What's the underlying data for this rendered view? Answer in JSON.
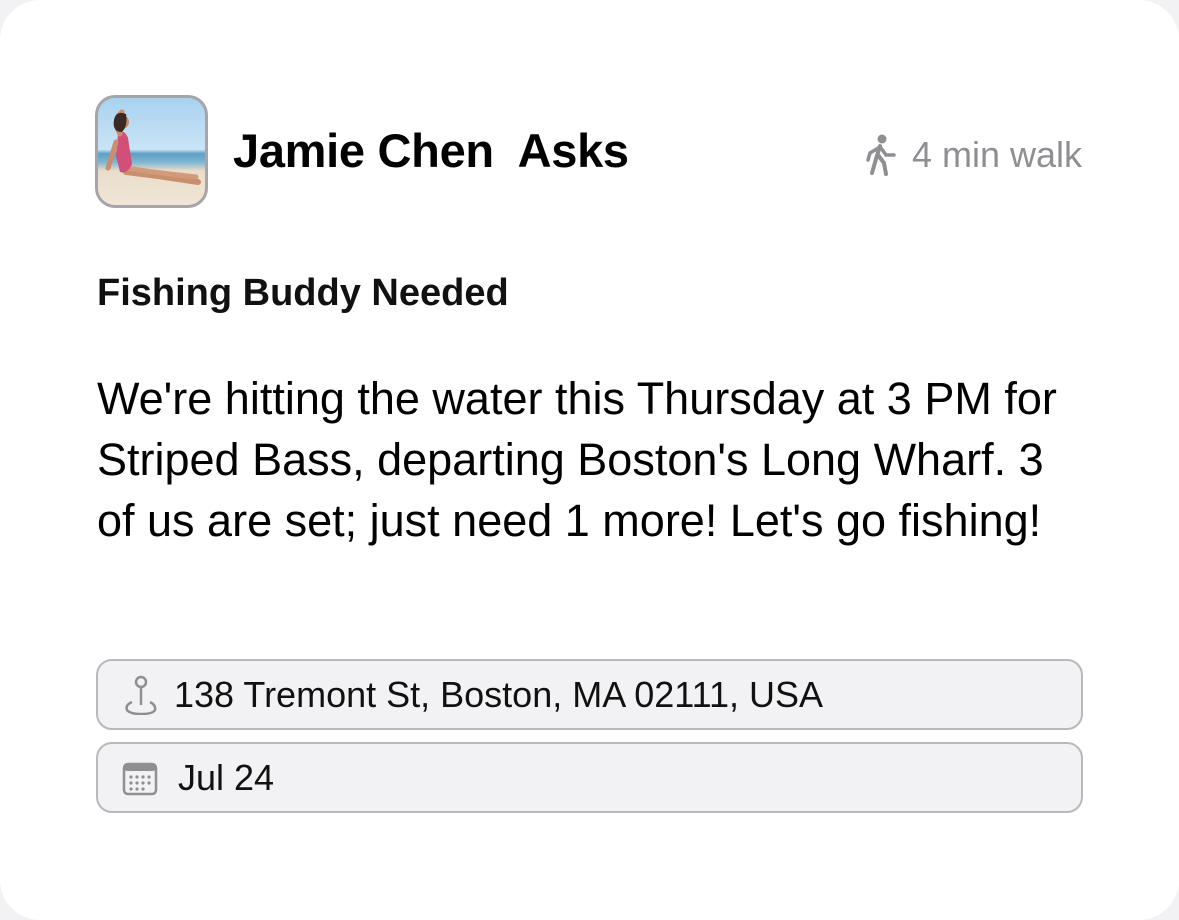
{
  "post": {
    "author_name": "Jamie Chen  Asks",
    "distance": "4 min walk",
    "title": "Fishing Buddy Needed",
    "body": "We're hitting the water this Thursday at 3 PM for Striped Bass, departing Boston's Long Wharf. 3 of us are set; just need 1 more! Let's go fishing!",
    "location": "138 Tremont St, Boston, MA 02111, USA",
    "date": "Jul 24"
  },
  "icons": {
    "distance": "walking-person-icon",
    "location": "location-pin-icon",
    "date": "calendar-icon"
  },
  "colors": {
    "secondary_text": "#8e8e93",
    "pill_background": "#f2f2f4",
    "pill_border": "#b9b9bd"
  }
}
